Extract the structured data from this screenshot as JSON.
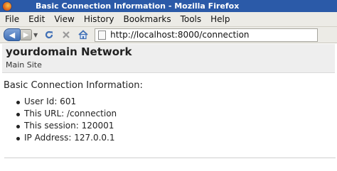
{
  "window": {
    "title": "Basic Connection Information - Mozilla Firefox"
  },
  "menu": {
    "items": [
      "File",
      "Edit",
      "View",
      "History",
      "Bookmarks",
      "Tools",
      "Help"
    ]
  },
  "toolbar": {
    "back_icon": "back-arrow-icon",
    "forward_icon": "forward-arrow-icon",
    "reload_icon": "reload-icon",
    "stop_icon": "stop-icon",
    "home_icon": "home-icon",
    "url": "http://localhost:8000/connection"
  },
  "page": {
    "site_name": "yourdomain Network",
    "site_subtitle": "Main Site",
    "section_title": "Basic Connection Information:",
    "info_items": [
      "User Id: 601",
      "This URL: /connection",
      "This session: 120001",
      "IP Address: 127.0.0.1"
    ]
  },
  "colors": {
    "titlebar": "#2b5aa8",
    "chrome": "#ecebe6",
    "header_band": "#eeeeee"
  }
}
